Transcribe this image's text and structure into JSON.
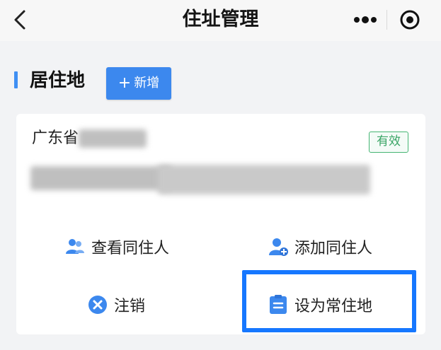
{
  "header": {
    "title": "住址管理",
    "icons": {
      "back": "back-chevron-icon",
      "more": "more-dots-icon",
      "target": "target-circle-icon"
    }
  },
  "section": {
    "title": "居住地",
    "add_button": {
      "plus": "+",
      "label": "新增"
    }
  },
  "card": {
    "province": "广东省",
    "status_badge": "有效",
    "actions": {
      "view_cohabitants": "查看同住人",
      "add_cohabitant": "添加同住人",
      "cancel": "注销",
      "set_primary": "设为常住地"
    }
  },
  "colors": {
    "accent": "#3c88ee",
    "badge_green": "#3aa566",
    "highlight": "#1677ff"
  }
}
